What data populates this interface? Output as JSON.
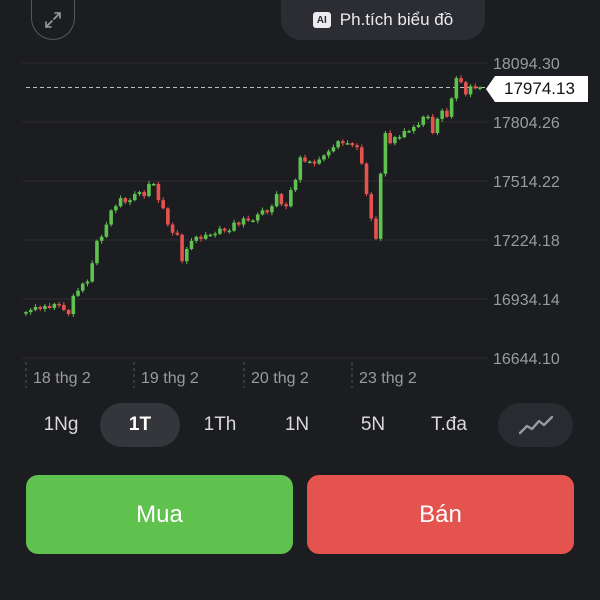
{
  "header": {
    "ai_badge": "AI",
    "analysis_label": "Ph.tích biểu đồ"
  },
  "chart_data": {
    "type": "candlestick",
    "y_axis": {
      "ticks": [
        "18094.30",
        "17804.26",
        "17514.22",
        "17224.18",
        "16934.14",
        "16644.10"
      ],
      "min": 16644.1,
      "max": 18094.3
    },
    "x_axis": {
      "ticks": [
        "18 thg 2",
        "19 thg 2",
        "20 thg 2",
        "23 thg 2"
      ]
    },
    "current_price": "17974.13",
    "colors": {
      "up": "#5fc24e",
      "down": "#e5534f",
      "grid": "#2b2c31",
      "text": "#9a9ba0"
    },
    "closes": [
      16870,
      16880,
      16895,
      16885,
      16900,
      16890,
      16910,
      16905,
      16880,
      16860,
      16950,
      16975,
      17010,
      17020,
      17110,
      17220,
      17240,
      17300,
      17370,
      17390,
      17430,
      17410,
      17420,
      17450,
      17460,
      17440,
      17500,
      17500,
      17420,
      17380,
      17300,
      17260,
      17250,
      17120,
      17180,
      17220,
      17240,
      17230,
      17250,
      17250,
      17255,
      17280,
      17270,
      17270,
      17310,
      17300,
      17330,
      17320,
      17320,
      17350,
      17370,
      17360,
      17390,
      17450,
      17400,
      17390,
      17470,
      17520,
      17630,
      17610,
      17610,
      17600,
      17620,
      17640,
      17660,
      17680,
      17710,
      17700,
      17700,
      17690,
      17680,
      17600,
      17450,
      17330,
      17230,
      17550,
      17750,
      17700,
      17730,
      17730,
      17760,
      17760,
      17780,
      17790,
      17830,
      17830,
      17750,
      17820,
      17860,
      17830,
      17920,
      18020,
      18000,
      17940,
      17980,
      17970,
      17974.13
    ]
  },
  "periods": {
    "items": [
      "1Ng",
      "1T",
      "1Th",
      "1N",
      "5N",
      "T.đa"
    ],
    "active_index": 1
  },
  "actions": {
    "buy_label": "Mua",
    "sell_label": "Bán"
  },
  "icons": {
    "expand": "expand-icon",
    "chart_type": "line-chart-icon"
  }
}
